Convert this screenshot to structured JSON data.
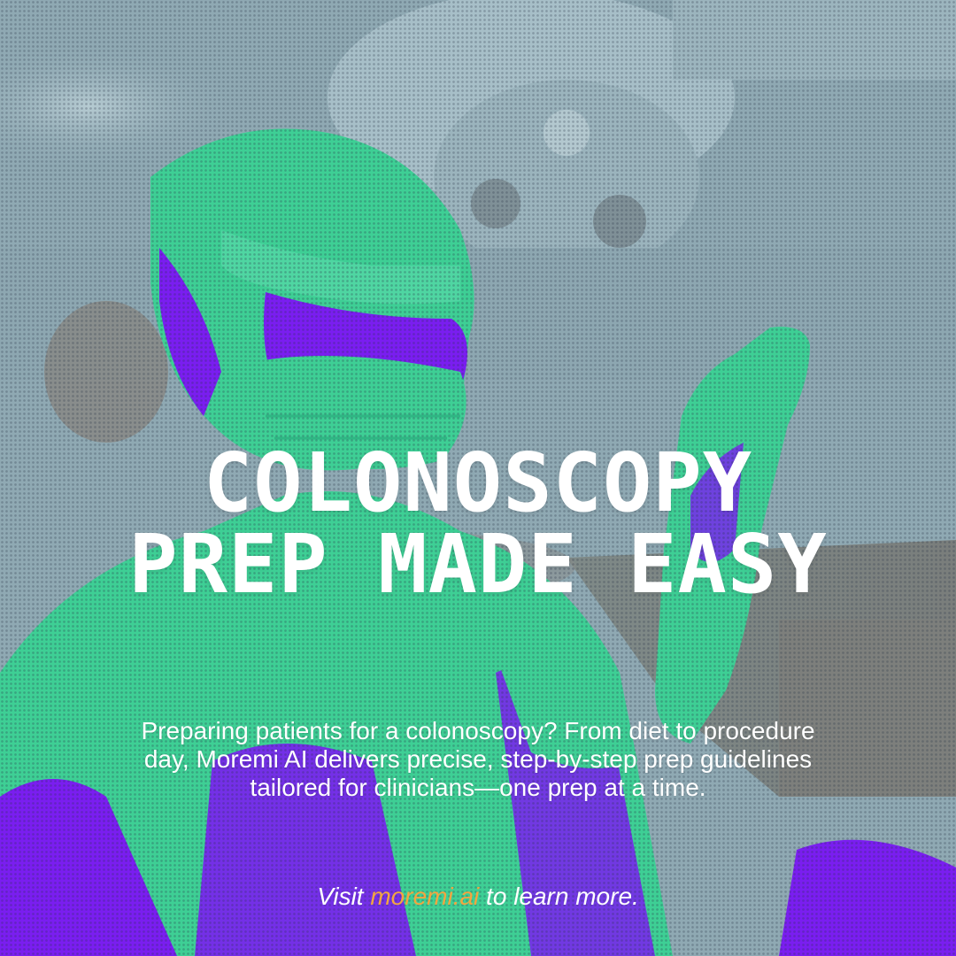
{
  "headline": {
    "line1": "COLONOSCOPY",
    "line2": "PREP MADE EASY"
  },
  "body": "Preparing patients for a colonoscopy? From diet to procedure day, Moremi AI delivers precise, step-by-step prep guidelines tailored for clinicians—one prep at a time.",
  "cta": {
    "prefix": "Visit ",
    "link": "moremi.ai",
    "suffix": " to learn more."
  },
  "colors": {
    "background": "#8fa9b3",
    "figure_green": "#3ecf95",
    "figure_violet": "#7a1ef0",
    "text": "#ffffff",
    "link": "#f2a640"
  },
  "image": {
    "subject": "surgeon-in-cap-and-mask-putting-on-glove-halftone-photo"
  }
}
